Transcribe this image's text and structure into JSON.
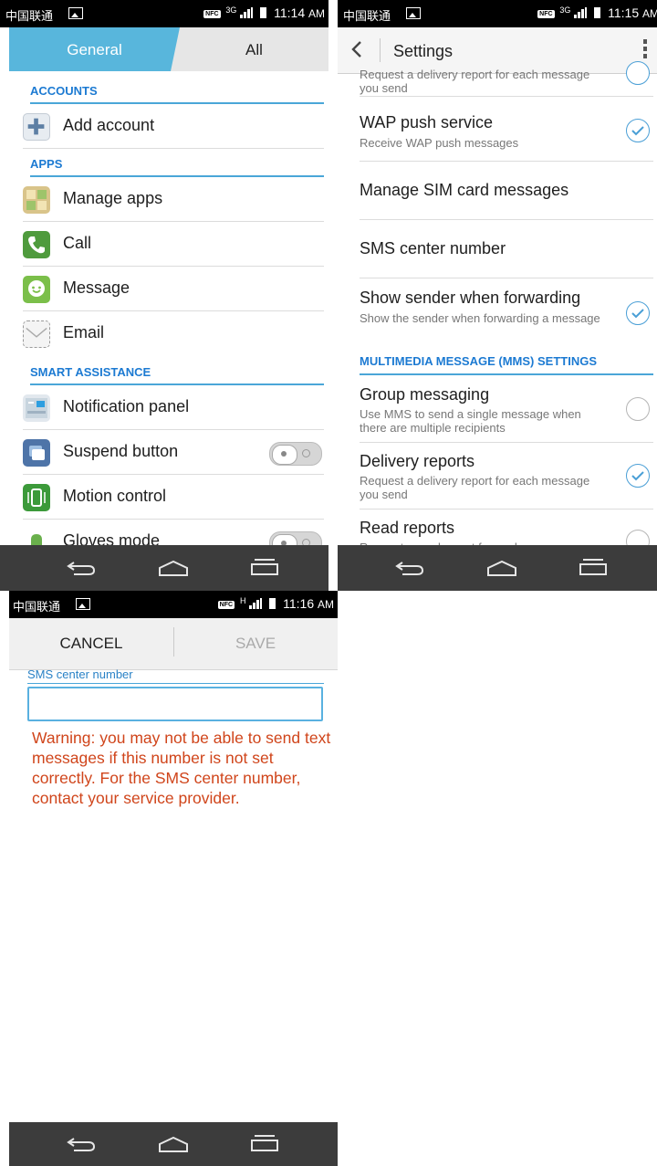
{
  "screen1": {
    "status": {
      "carrier": "中国联通",
      "network": "3G",
      "time": "11:14",
      "ampm": "AM"
    },
    "tabs": {
      "general": "General",
      "all": "All"
    },
    "sections": [
      {
        "header": "ACCOUNTS",
        "items": [
          {
            "label": "Add account",
            "icon": "plus-icon"
          }
        ]
      },
      {
        "header": "APPS",
        "items": [
          {
            "label": "Manage apps",
            "icon": "grid-icon"
          },
          {
            "label": "Call",
            "icon": "phone-icon"
          },
          {
            "label": "Message",
            "icon": "chat-icon"
          },
          {
            "label": "Email",
            "icon": "envelope-icon"
          }
        ]
      },
      {
        "header": "SMART ASSISTANCE",
        "items": [
          {
            "label": "Notification panel",
            "icon": "notification-icon"
          },
          {
            "label": "Suspend button",
            "icon": "suspend-icon",
            "toggle": false
          },
          {
            "label": "Motion control",
            "icon": "motion-icon"
          },
          {
            "label": "Gloves mode",
            "icon": "gloves-icon",
            "toggle": false
          }
        ]
      }
    ]
  },
  "screen2": {
    "status": {
      "carrier": "中国联通",
      "network": "3G",
      "time": "11:15",
      "ampm": "AM"
    },
    "title": "Settings",
    "clipped_top_subtitle": "Request a delivery report for each message you send",
    "items": [
      {
        "title": "WAP push service",
        "subtitle": "Receive WAP push messages",
        "checked": true
      },
      {
        "title": "Manage SIM card messages"
      },
      {
        "title": "SMS center number"
      },
      {
        "title": "Show sender when forwarding",
        "subtitle": "Show the sender when forwarding a message",
        "checked": true
      }
    ],
    "mms_header": "MULTIMEDIA MESSAGE (MMS) SETTINGS",
    "mms_items": [
      {
        "title": "Group messaging",
        "subtitle": "Use MMS to send a single message when there are multiple recipients",
        "checked": false
      },
      {
        "title": "Delivery reports",
        "subtitle": "Request a delivery report for each message you send",
        "checked": true
      },
      {
        "title": "Read reports",
        "subtitle": "Request a read report for each message",
        "checked": false
      }
    ]
  },
  "screen3": {
    "status": {
      "carrier": "中国联通",
      "network": "H",
      "time": "11:16",
      "ampm": "AM"
    },
    "cancel_label": "CANCEL",
    "save_label": "SAVE",
    "field_label": "SMS center number",
    "field_value": "",
    "warning": "Warning: you may not be able to send text messages if this number is not set correctly. For the SMS center number, contact your service provider."
  },
  "colors": {
    "accent": "#58b6dc",
    "section": "#1c7ad2",
    "warning": "#d0451b",
    "navbar": "#3c3c3c"
  }
}
